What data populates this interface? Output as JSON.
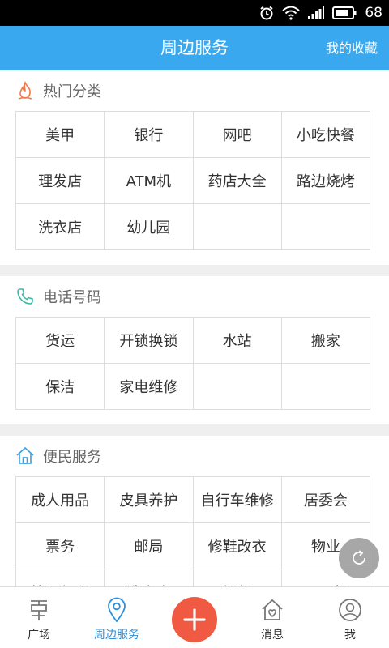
{
  "status_bar": {
    "battery": "68"
  },
  "header": {
    "title": "周边服务",
    "favorites": "我的收藏"
  },
  "sections": [
    {
      "title": "热门分类",
      "icon": "flame-icon",
      "items": [
        "美甲",
        "银行",
        "网吧",
        "小吃快餐",
        "理发店",
        "ATM机",
        "药店大全",
        "路边烧烤",
        "洗衣店",
        "幼儿园",
        "",
        ""
      ]
    },
    {
      "title": "电话号码",
      "icon": "phone-icon",
      "items": [
        "货运",
        "开锁换锁",
        "水站",
        "搬家",
        "保洁",
        "家电维修",
        "",
        ""
      ]
    },
    {
      "title": "便民服务",
      "icon": "house-icon",
      "items": [
        "成人用品",
        "皮具养护",
        "自行车维修",
        "居委会",
        "票务",
        "邮局",
        "修鞋改衣",
        "物业",
        "快照复印",
        "洗衣店",
        "银行",
        "ATM机"
      ]
    }
  ],
  "tabs": [
    {
      "label": "广场",
      "icon": "square-plaza-icon"
    },
    {
      "label": "周边服务",
      "icon": "location-pin-icon"
    },
    {
      "label": "消息",
      "icon": "message-home-icon"
    },
    {
      "label": "我",
      "icon": "user-icon"
    }
  ],
  "colors": {
    "header": "#39a8ef",
    "accent": "#2f8fd8",
    "add_button": "#f05a42",
    "flame": "#f07a4a",
    "phone": "#3bb8a6",
    "house": "#3aa0e0"
  }
}
